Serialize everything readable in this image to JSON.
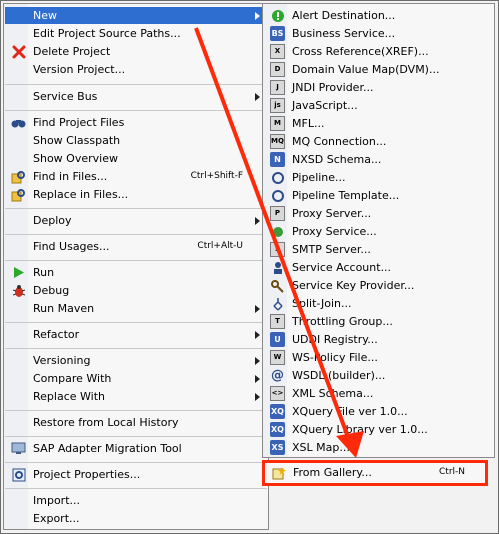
{
  "main_menu": {
    "items": [
      {
        "label": "New",
        "submenu": true,
        "highlighted": true
      },
      {
        "label": "Edit Project Source Paths..."
      },
      {
        "label": "Delete Project",
        "icon": "delete-icon"
      },
      {
        "label": "Version Project..."
      },
      {
        "label": "Service Bus",
        "submenu": true
      },
      {
        "label": "Find Project Files",
        "icon": "binoculars-icon"
      },
      {
        "label": "Show Classpath"
      },
      {
        "label": "Show Overview"
      },
      {
        "label": "Find in Files...",
        "icon": "find-in-files-icon",
        "shortcut": "Ctrl+Shift-F"
      },
      {
        "label": "Replace in Files...",
        "icon": "replace-in-files-icon"
      },
      {
        "label": "Deploy",
        "submenu": true
      },
      {
        "label": "Find Usages...",
        "shortcut": "Ctrl+Alt-U"
      },
      {
        "label": "Run",
        "icon": "run-icon"
      },
      {
        "label": "Debug",
        "icon": "bug-icon"
      },
      {
        "label": "Run Maven",
        "submenu": true
      },
      {
        "label": "Refactor",
        "submenu": true
      },
      {
        "label": "Versioning",
        "submenu": true
      },
      {
        "label": "Compare With",
        "submenu": true
      },
      {
        "label": "Replace With",
        "submenu": true
      },
      {
        "label": "Restore from Local History"
      },
      {
        "label": "SAP Adapter Migration Tool",
        "icon": "sap-adapter-icon"
      },
      {
        "label": "Project Properties...",
        "icon": "properties-icon"
      },
      {
        "label": "Import..."
      },
      {
        "label": "Export..."
      }
    ]
  },
  "sub_menu": {
    "items": [
      {
        "label": "Alert Destination...",
        "icon": "alert-destination-icon"
      },
      {
        "label": "Business Service...",
        "icon": "business-service-icon"
      },
      {
        "label": "Cross Reference(XREF)...",
        "icon": "cross-reference-icon"
      },
      {
        "label": "Domain Value Map(DVM)...",
        "icon": "domain-value-map-icon"
      },
      {
        "label": "JNDI Provider...",
        "icon": "jndi-provider-icon"
      },
      {
        "label": "JavaScript...",
        "icon": "javascript-icon"
      },
      {
        "label": "MFL...",
        "icon": "mfl-icon"
      },
      {
        "label": "MQ Connection...",
        "icon": "mq-connection-icon"
      },
      {
        "label": "NXSD Schema...",
        "icon": "nxsd-schema-icon"
      },
      {
        "label": "Pipeline...",
        "icon": "pipeline-icon"
      },
      {
        "label": "Pipeline Template...",
        "icon": "pipeline-template-icon"
      },
      {
        "label": "Proxy Server...",
        "icon": "proxy-server-icon"
      },
      {
        "label": "Proxy Service...",
        "icon": "proxy-service-icon"
      },
      {
        "label": "SMTP Server...",
        "icon": "smtp-server-icon"
      },
      {
        "label": "Service Account...",
        "icon": "service-account-icon"
      },
      {
        "label": "Service Key Provider...",
        "icon": "service-key-provider-icon"
      },
      {
        "label": "Split-Join...",
        "icon": "split-join-icon"
      },
      {
        "label": "Throttling Group...",
        "icon": "throttling-group-icon"
      },
      {
        "label": "UDDI Registry...",
        "icon": "uddi-registry-icon"
      },
      {
        "label": "WS-Policy File...",
        "icon": "ws-policy-icon"
      },
      {
        "label": "WSDL (builder)...",
        "icon": "wsdl-icon"
      },
      {
        "label": "XML Schema...",
        "icon": "xml-schema-icon"
      },
      {
        "label": "XQuery File ver 1.0...",
        "icon": "xquery-file-icon"
      },
      {
        "label": "XQuery Library ver 1.0...",
        "icon": "xquery-library-icon"
      },
      {
        "label": "XSL Map...",
        "icon": "xsl-map-icon"
      },
      {
        "label": "From Gallery...",
        "icon": "gallery-icon",
        "shortcut": "Ctrl-N"
      }
    ]
  },
  "colors": {
    "highlight": "#2f6ed1",
    "annotation": "#ff2a0a"
  }
}
